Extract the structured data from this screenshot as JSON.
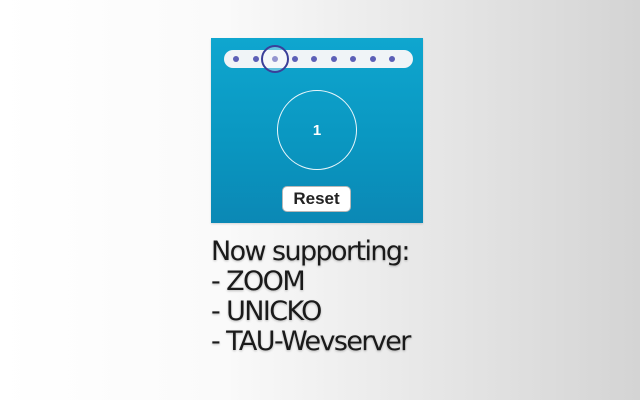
{
  "widget": {
    "slider": {
      "dot_count": 9,
      "selected_index": 2
    },
    "counter": {
      "value": "1"
    },
    "reset_label": "Reset"
  },
  "caption": {
    "heading": "Now supporting:",
    "items": [
      "- ZOOM",
      "- UNICKO",
      "- TAU-Wevserver"
    ]
  },
  "colors": {
    "panel_top": "#0fa6cf",
    "panel_bottom": "#0b88b5",
    "slider_dot": "#5b5fb6",
    "slider_handle_border": "#3b3f99"
  }
}
